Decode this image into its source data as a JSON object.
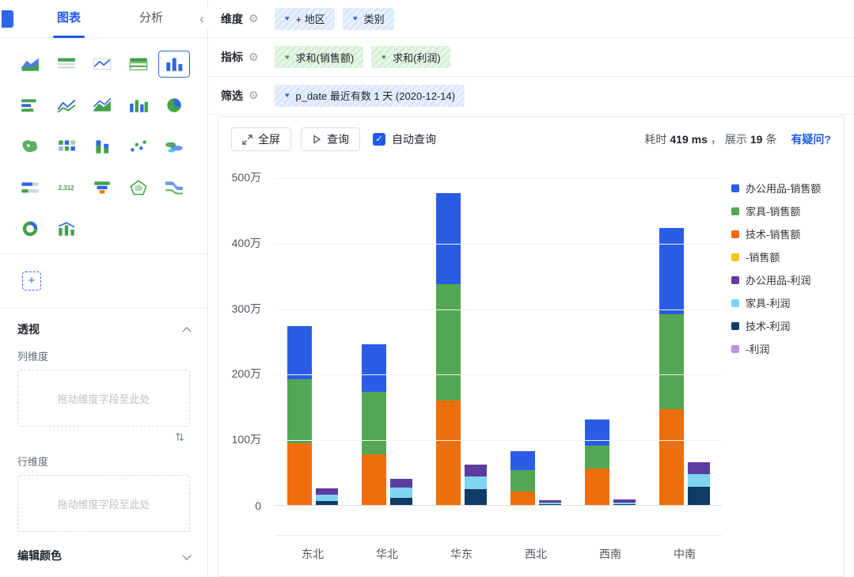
{
  "sidebar": {
    "tabs": [
      {
        "label": "图表"
      },
      {
        "label": "分析"
      }
    ],
    "collapse_icon": "‹",
    "add_label": "+",
    "chart_icons": [
      {
        "name": "area-table-icon",
        "glyph": "area"
      },
      {
        "name": "table-icon",
        "glyph": "table"
      },
      {
        "name": "line-table-icon",
        "glyph": "linetable"
      },
      {
        "name": "grid-table-icon",
        "glyph": "table2"
      },
      {
        "name": "histogram-icon",
        "glyph": "bars",
        "selected": true
      },
      {
        "name": "horizontal-bar-icon",
        "glyph": "hbars"
      },
      {
        "name": "line-chart-icon",
        "glyph": "line"
      },
      {
        "name": "area-chart-icon",
        "glyph": "area2"
      },
      {
        "name": "column-chart-icon",
        "glyph": "bars2"
      },
      {
        "name": "pie-chart-icon",
        "glyph": "pie"
      },
      {
        "name": "map-chart-icon",
        "glyph": "map"
      },
      {
        "name": "heat-grid-icon",
        "glyph": "grid"
      },
      {
        "name": "stacked-column-icon",
        "glyph": "stack"
      },
      {
        "name": "scatter-chart-icon",
        "glyph": "scatter"
      },
      {
        "name": "word-cloud-icon",
        "glyph": "cloud"
      },
      {
        "name": "progress-chart-icon",
        "glyph": "progress"
      },
      {
        "name": "kpi-card-icon",
        "glyph": "kpi",
        "label": "2,312"
      },
      {
        "name": "funnel-chart-icon",
        "glyph": "funnel"
      },
      {
        "name": "radar-chart-icon",
        "glyph": "radar"
      },
      {
        "name": "sankey-chart-icon",
        "glyph": "sankey"
      },
      {
        "name": "donut-chart-icon",
        "glyph": "donut"
      },
      {
        "name": "combo-chart-icon",
        "glyph": "combo"
      }
    ],
    "pivot": {
      "title": "透视",
      "column_label": "列维度",
      "column_placeholder": "拖动维度字段至此处",
      "row_label": "行维度",
      "row_placeholder": "拖动维度字段至此处"
    },
    "edit_color_title": "编辑颜色"
  },
  "config": {
    "rows": [
      {
        "label": "维度",
        "chips": [
          {
            "text": "+ 地区"
          },
          {
            "text": "类别"
          }
        ]
      },
      {
        "label": "指标",
        "chips": [
          {
            "text": "求和(销售额)"
          },
          {
            "text": "求和(利润)"
          }
        ]
      },
      {
        "label": "筛选",
        "chips": [
          {
            "text": "p_date 最近有数 1 天 (2020-12-14)"
          }
        ]
      }
    ]
  },
  "toolbar": {
    "fullscreen_label": "全屏",
    "query_label": "查询",
    "auto_query_label": "自动查询",
    "auto_query_checked": true,
    "checkmark": "✓",
    "stats": {
      "elapsed_label": "耗时",
      "elapsed_value": "419 ms",
      "separator": "，",
      "shown_label": "展示",
      "shown_count": "19",
      "shown_unit": "条",
      "help_link": "有疑问?"
    }
  },
  "colors": {
    "accent": "#1E5BEB"
  },
  "chart_data": {
    "type": "bar",
    "stacked": true,
    "grid": true,
    "legend_position": "right",
    "categories": [
      "东北",
      "华北",
      "华东",
      "西北",
      "西南",
      "中南"
    ],
    "unit": "万",
    "ylim": [
      0,
      500
    ],
    "yticks": [
      "0",
      "100万",
      "200万",
      "300万",
      "400万",
      "500万"
    ],
    "groups": [
      {
        "name": "销售额",
        "series": [
          {
            "name": "技术-销售额",
            "color": "#EE6E0D",
            "values": [
              96,
              79,
              161,
              22,
              57,
              148
            ]
          },
          {
            "name": "家具-销售额",
            "color": "#53A653",
            "values": [
              98,
              96,
              178,
              33,
              36,
              146
            ]
          },
          {
            "name": "办公用品-销售额",
            "color": "#2A5CE6",
            "values": [
              82,
              73,
              140,
              29,
              39,
              132
            ]
          },
          {
            "name": "-销售额",
            "color": "#F7C51E",
            "values": [
              0,
              0,
              0,
              0,
              0,
              0
            ]
          }
        ]
      },
      {
        "name": "利润",
        "series": [
          {
            "name": "技术-利润",
            "color": "#0E3C66",
            "values": [
              8,
              13,
              26,
              3,
              3,
              30
            ]
          },
          {
            "name": "家具-利润",
            "color": "#7FD4F2",
            "values": [
              9,
              15,
              19,
              3,
              3,
              19
            ]
          },
          {
            "name": "办公用品-利润",
            "color": "#5C3C9E",
            "values": [
              10,
              14,
              18,
              3,
              4,
              18
            ]
          },
          {
            "name": "-利润",
            "color": "#B892DB",
            "values": [
              0,
              0,
              0,
              0,
              0,
              0
            ]
          }
        ]
      }
    ],
    "legend": [
      {
        "label": "办公用品-销售额",
        "color": "#2A5CE6"
      },
      {
        "label": "家具-销售额",
        "color": "#53A653"
      },
      {
        "label": "技术-销售额",
        "color": "#EE6E0D"
      },
      {
        "label": "-销售额",
        "color": "#F7C51E"
      },
      {
        "label": "办公用品-利润",
        "color": "#5C3C9E"
      },
      {
        "label": "家具-利润",
        "color": "#7FD4F2"
      },
      {
        "label": "技术-利润",
        "color": "#0E3C66"
      },
      {
        "label": "-利润",
        "color": "#B892DB"
      }
    ]
  }
}
